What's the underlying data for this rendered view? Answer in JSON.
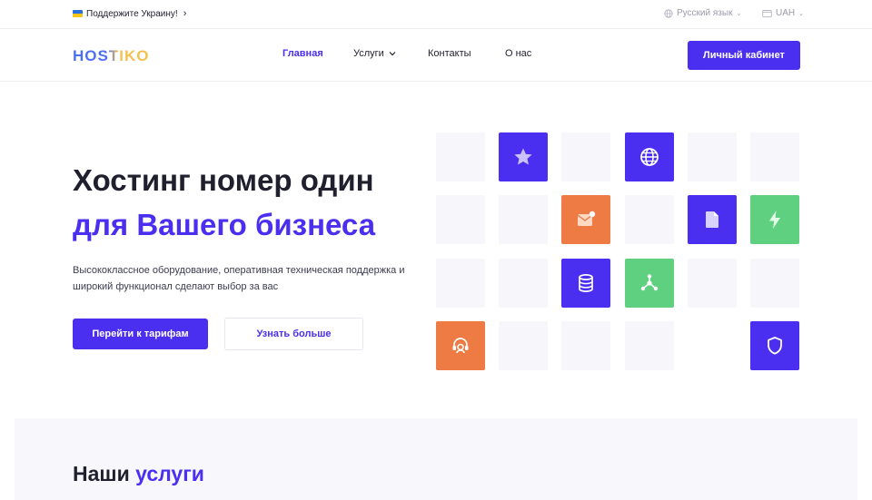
{
  "topbar": {
    "ukraine_link": "Поддержите Украину!",
    "language": "Русский язык",
    "currency": "UAH"
  },
  "header": {
    "logo": "HOSTIKO",
    "nav": {
      "home": "Главная",
      "services": "Услуги",
      "contacts": "Контакты",
      "about": "О нас"
    },
    "cabinet_button": "Личный кабинет"
  },
  "hero": {
    "title_line1": "Хостинг номер один",
    "title_line2": "для Вашего бизнеса",
    "description_line1": "Высококлассное оборудование, оперативная техническая поддержка и",
    "description_line2": "широкий функционал сделают выбор за вас",
    "primary_button": "Перейти к тарифам",
    "secondary_button": "Узнать больше"
  },
  "services": {
    "title_plain": "Наши",
    "title_accent": "услуги"
  },
  "colors": {
    "accent": "#4a2ff0",
    "orange": "#ee7a44",
    "green": "#5fcf80",
    "tile_bg": "#f6f6fb"
  },
  "tiles": [
    {
      "icon": "star-icon",
      "color": "purple"
    },
    {
      "icon": "globe-icon",
      "color": "purple"
    },
    {
      "icon": "mail-icon",
      "color": "orange"
    },
    {
      "icon": "file-icon",
      "color": "purple"
    },
    {
      "icon": "lightning-icon",
      "color": "green"
    },
    {
      "icon": "database-icon",
      "color": "purple"
    },
    {
      "icon": "network-icon",
      "color": "green"
    },
    {
      "icon": "support-icon",
      "color": "orange"
    },
    {
      "icon": "shield-icon",
      "color": "purple"
    }
  ]
}
